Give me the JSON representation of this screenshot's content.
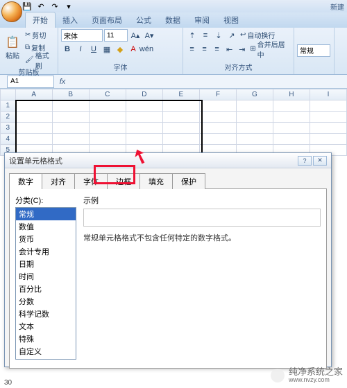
{
  "title_right": "新建",
  "ribbon_tabs": [
    "开始",
    "插入",
    "页面布局",
    "公式",
    "数据",
    "审阅",
    "视图"
  ],
  "active_tab_index": 0,
  "clipboard": {
    "paste": "粘贴",
    "cut": "剪切",
    "copy": "复制",
    "format_painter": "格式刷",
    "group": "剪贴板"
  },
  "font": {
    "family": "宋体",
    "size": "11",
    "group": "字体"
  },
  "alignment": {
    "wrap": "自动换行",
    "merge": "合并后居中",
    "group": "对齐方式"
  },
  "number_group": {
    "format": "常规"
  },
  "namebox": "A1",
  "fx": "fx",
  "columns": [
    "A",
    "B",
    "C",
    "D",
    "E",
    "F",
    "G",
    "H",
    "I"
  ],
  "rows": [
    "1",
    "2",
    "3",
    "4",
    "5"
  ],
  "dialog": {
    "title": "设置单元格格式",
    "tabs": [
      "数字",
      "对齐",
      "字体",
      "边框",
      "填充",
      "保护"
    ],
    "active_tab_index": 0,
    "category_label": "分类(C):",
    "categories": [
      "常规",
      "数值",
      "货币",
      "会计专用",
      "日期",
      "时间",
      "百分比",
      "分数",
      "科学记数",
      "文本",
      "特殊",
      "自定义"
    ],
    "selected_category_index": 0,
    "sample_label": "示例",
    "description": "常规单元格格式不包含任何特定的数字格式。"
  },
  "watermark": {
    "line1": "纯净系统之家",
    "line2": "www.nvzy.com"
  },
  "status_text": "30"
}
